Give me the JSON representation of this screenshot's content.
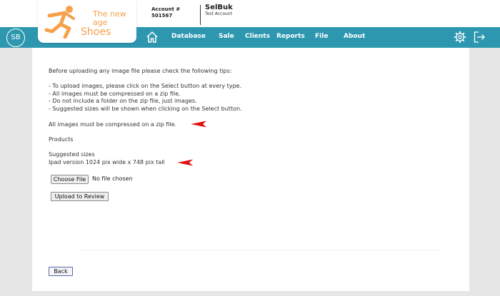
{
  "header": {
    "logo": {
      "line1": "The new",
      "line2": "age",
      "line3": "Shoes"
    },
    "account": {
      "label": "Account #",
      "number": "501567"
    },
    "brand": {
      "name": "SelBuk",
      "subtitle": "Test Account"
    },
    "badge": "SB"
  },
  "nav": {
    "items": [
      {
        "label": "Database"
      },
      {
        "label": "Sale"
      },
      {
        "label": "Clients"
      },
      {
        "label": "Reports"
      },
      {
        "label": "File"
      },
      {
        "label": "About"
      }
    ],
    "icons": [
      "home-icon",
      "gear-icon",
      "logout-icon"
    ]
  },
  "content": {
    "intro": "Before uploading any image file please check the following tips:",
    "tips": [
      "- To upload images, please click on the Select button at every type.",
      "- All images must be compressed on a zip file.",
      "- Do not include a folder on the zip file, just images.",
      "- Suggested sizes will be shown when clicking on the Select button."
    ],
    "notice": "All images must be compressed on a zip file.",
    "section": "Products",
    "sizes_label": "Suggested sizes",
    "sizes_value": "Ipad version 1024 pix wide x 748 pix tall",
    "file_button": "Choose File",
    "file_status": "No file chosen",
    "upload_button": "Upload to Review",
    "back_button": "Back"
  },
  "colors": {
    "nav_bg": "#2e97b0",
    "logo_accent": "#f5a04a",
    "arrow": "#e01010",
    "page_bg": "#e6e6e6"
  }
}
